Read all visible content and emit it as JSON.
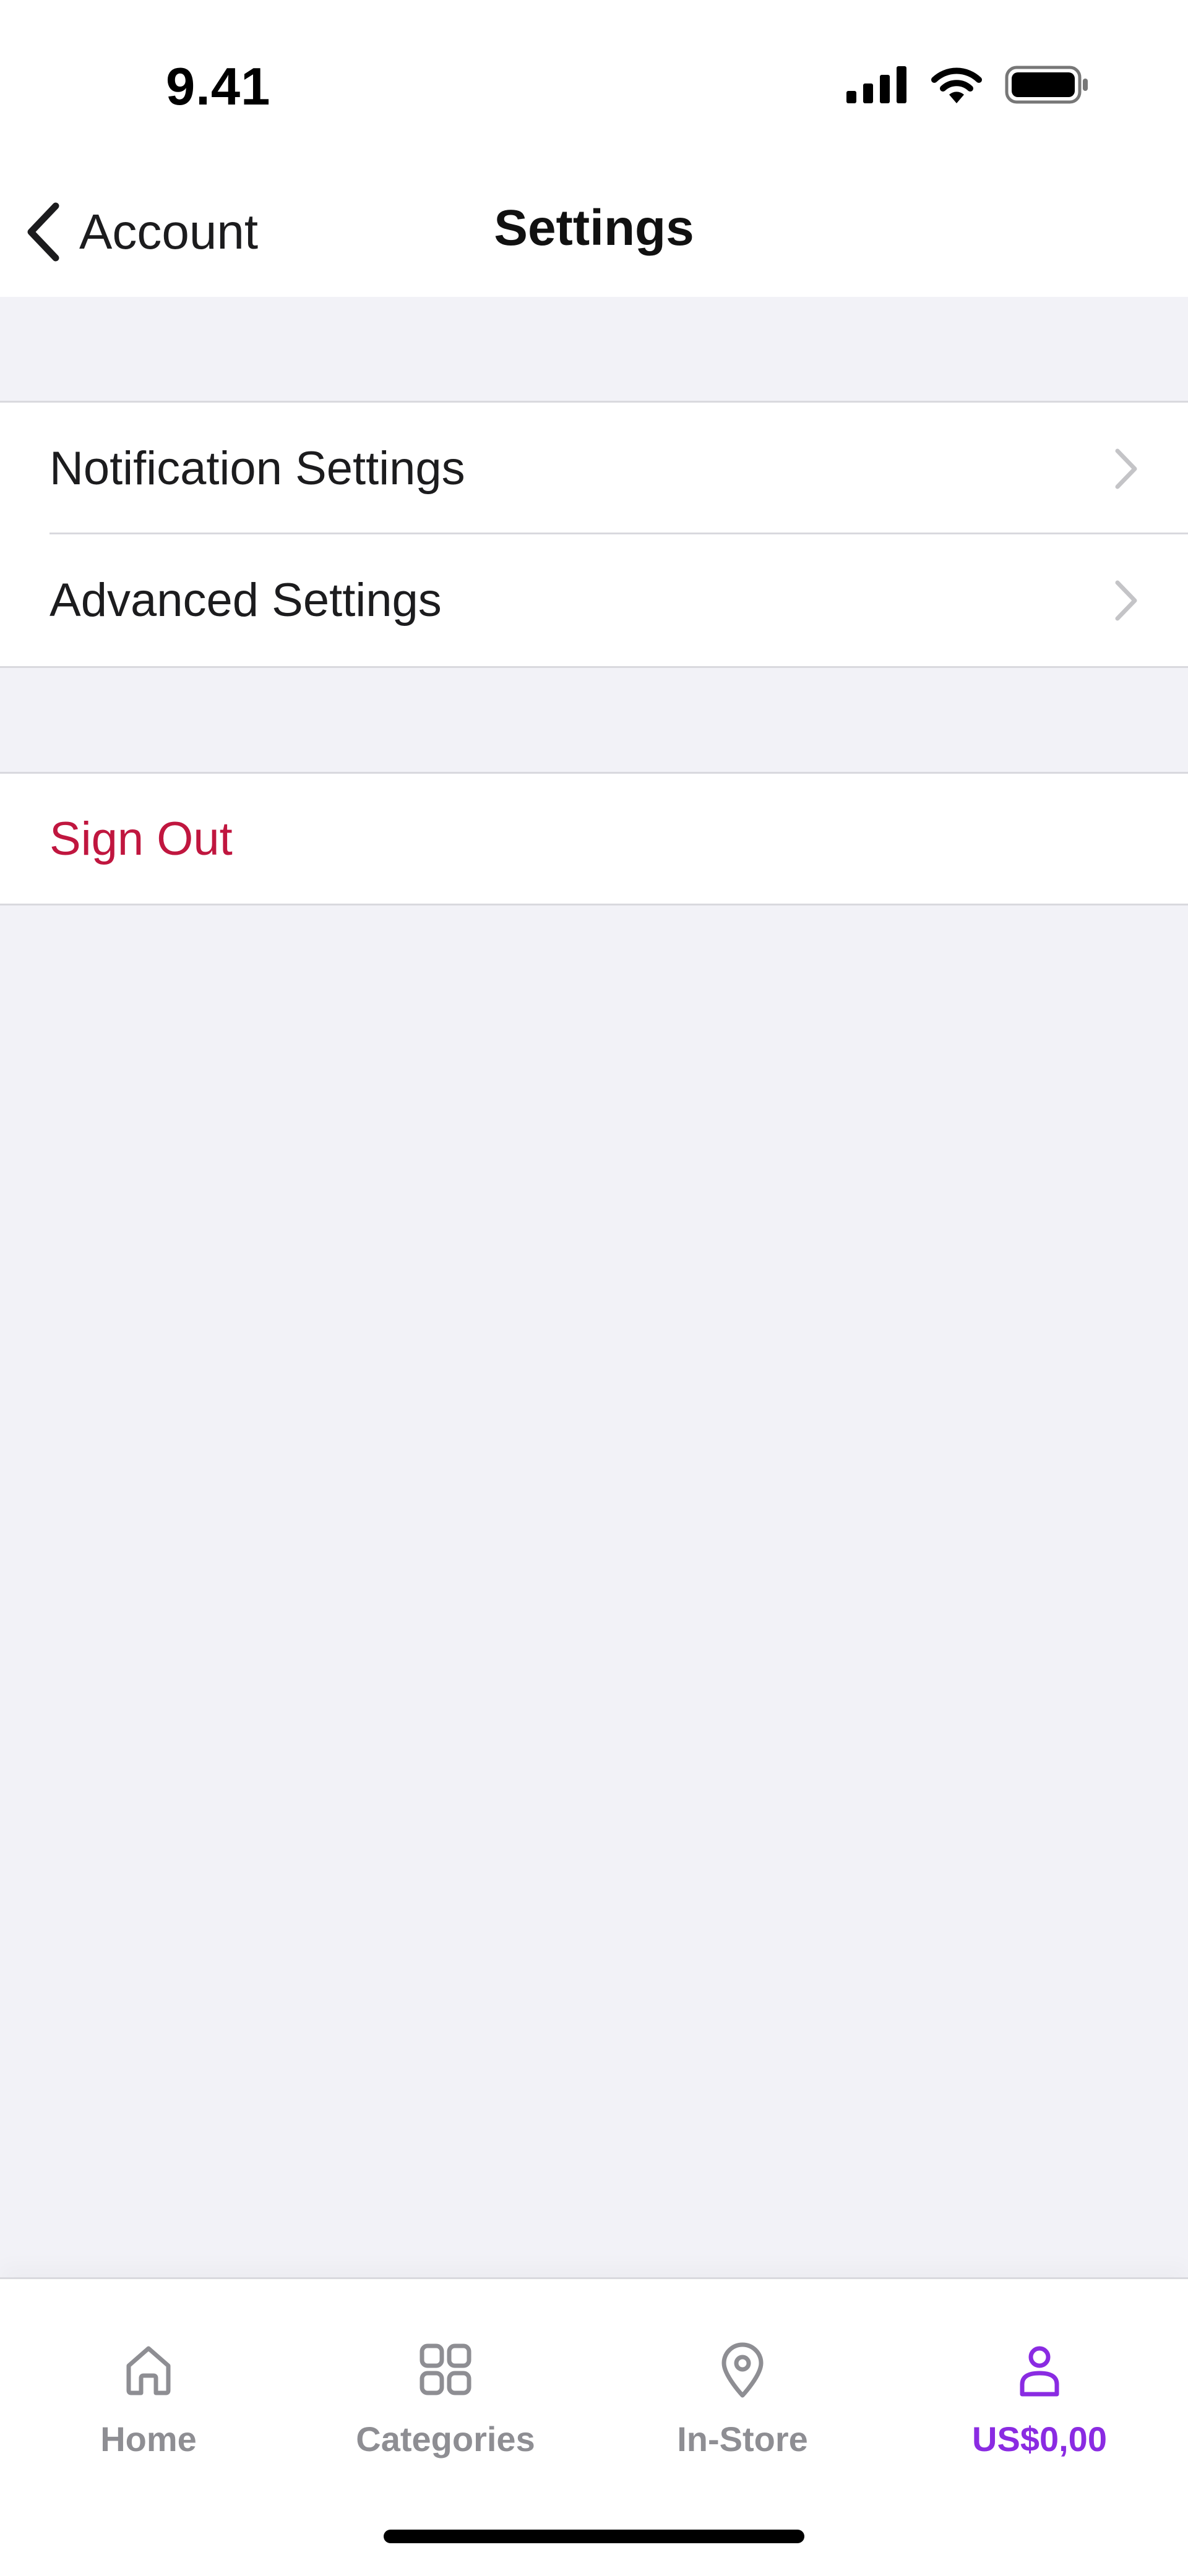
{
  "status_bar": {
    "time": "9.41",
    "icons": [
      "cellular-signal-icon",
      "wifi-icon",
      "battery-icon"
    ]
  },
  "nav": {
    "back_label": "Account",
    "title": "Settings"
  },
  "settings": {
    "items": [
      {
        "label": "Notification Settings"
      },
      {
        "label": "Advanced Settings"
      }
    ],
    "sign_out_label": "Sign Out"
  },
  "tab_bar": {
    "tabs": [
      {
        "label": "Home",
        "icon": "home-icon",
        "active": false
      },
      {
        "label": "Categories",
        "icon": "grid-icon",
        "active": false
      },
      {
        "label": "In-Store",
        "icon": "location-pin-icon",
        "active": false
      },
      {
        "label": "US$0,00",
        "icon": "person-icon",
        "active": true
      }
    ]
  },
  "colors": {
    "accent": "#8a2be2",
    "sign_out": "#c0163f",
    "inactive_tab": "#8e8e93",
    "background": "#f2f2f7"
  }
}
